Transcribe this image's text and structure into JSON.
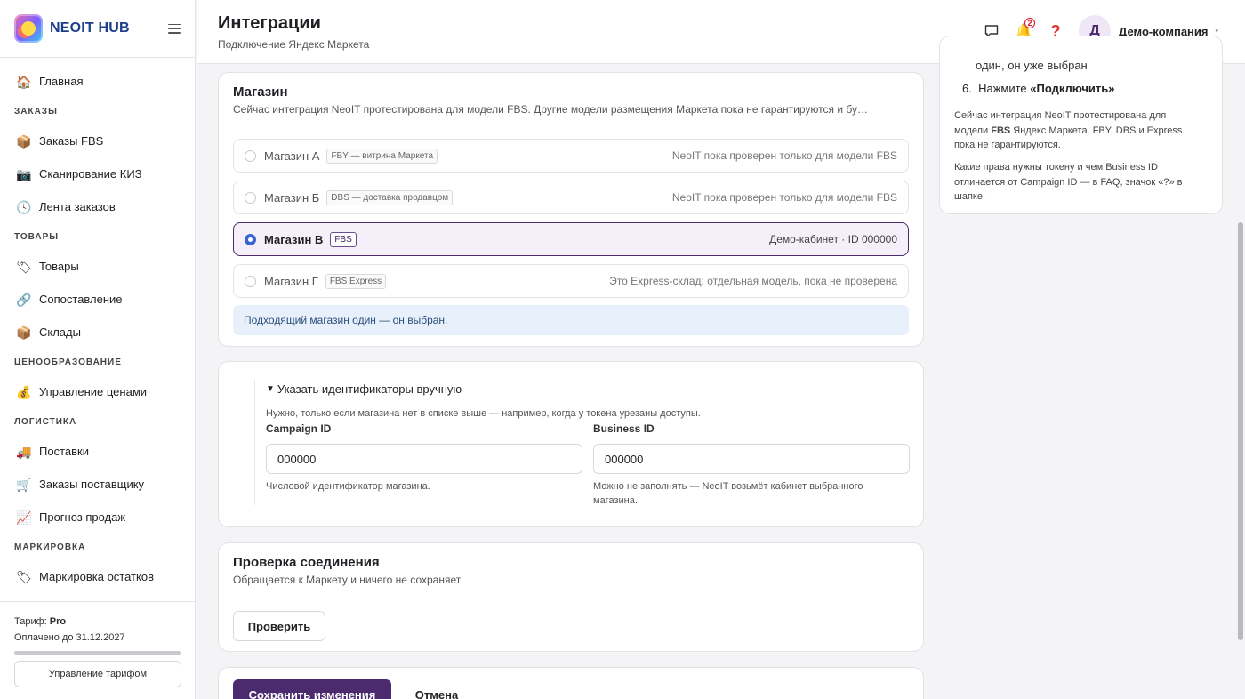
{
  "app": {
    "brand": "NEOIT HUB"
  },
  "sidebar": {
    "items": [
      {
        "label": "Главная",
        "icon": "🏠"
      },
      {
        "section": "ЗАКАЗЫ"
      },
      {
        "label": "Заказы FBS",
        "icon": "📦"
      },
      {
        "label": "Сканирование КИЗ",
        "icon": "📷"
      },
      {
        "label": "Лента заказов",
        "icon": "🕓"
      },
      {
        "section": "ТОВАРЫ"
      },
      {
        "label": "Товары",
        "icon": "🏷"
      },
      {
        "label": "Сопоставление",
        "icon": "🔗"
      },
      {
        "label": "Склады",
        "icon": "📦"
      },
      {
        "section": "ЦЕНООБРАЗОВАНИЕ"
      },
      {
        "label": "Управление ценами",
        "icon": "💰"
      },
      {
        "section": "ЛОГИСТИКА"
      },
      {
        "label": "Поставки",
        "icon": "🚚"
      },
      {
        "label": "Заказы поставщику",
        "icon": "🛒"
      },
      {
        "label": "Прогноз продаж",
        "icon": "📈"
      },
      {
        "section": "МАРКИРОВКА"
      },
      {
        "label": "Маркировка остатков",
        "icon": "🏷"
      }
    ],
    "footer": {
      "plan_label": "Тариф:",
      "plan_value": "Pro",
      "paid_until": "Оплачено до 31.12.2027",
      "manage_button": "Управление тарифом"
    }
  },
  "header": {
    "title": "Интеграции",
    "subtitle": "Подключение Яндекс Маркета",
    "notifications_count": "2",
    "help_glyph": "?",
    "avatar_letter": "Д",
    "company": "Демо-компания"
  },
  "store_card": {
    "title": "Магазин",
    "subtitle": "Сейчас интеграция NeoIT протестирована для модели FBS. Другие модели размещения Маркета пока не гарантируются и бу…",
    "stores": [
      {
        "name": "Магазин А",
        "tag": "FBY — витрина Маркета",
        "note": "NeoIT пока проверен только для модели FBS",
        "selected": false
      },
      {
        "name": "Магазин Б",
        "tag": "DBS — доставка продавцом",
        "note": "NeoIT пока проверен только для модели FBS",
        "selected": false
      },
      {
        "name": "Магазин В",
        "tag": "FBS",
        "note": "Демо-кабинет · ID 000000",
        "selected": true
      },
      {
        "name": "Магазин Г",
        "tag": "FBS Express",
        "note": "Это Express-склад: отдельная модель, пока не проверена",
        "selected": false
      }
    ],
    "info": "Подходящий магазин один — он выбран."
  },
  "ids_card": {
    "summary": "Указать идентификаторы вручную",
    "hint": "Нужно, только если магазина нет в списке выше — например, когда у токена урезаны доступы.",
    "campaign": {
      "label": "Campaign ID",
      "value": "000000",
      "help": "Числовой идентификатор магазина."
    },
    "business": {
      "label": "Business ID",
      "value": "000000",
      "help": "Можно не заполнять — NeoIT возьмёт кабинет выбранного магазина."
    }
  },
  "check_card": {
    "title": "Проверка соединения",
    "subtitle": "Обращается к Маркету и ничего не сохраняет",
    "button": "Проверить"
  },
  "actions": {
    "save": "Сохранить изменения",
    "cancel": "Отмена"
  },
  "help_panel": {
    "prev_step_tail": "один, он уже выбран",
    "step6_prefix": "Нажмите ",
    "step6_bold": "«Подключить»",
    "para1_prefix": "Сейчас интеграция NeoIT протестирована для модели ",
    "para1_bold": "FBS",
    "para1_suffix": " Яндекс Маркета. FBY, DBS и Express пока не гарантируются.",
    "para2": "Какие права нужны токену и чем Business ID отличается от Campaign ID — в FAQ, значок «?» в шапке."
  },
  "colors": {
    "accent": "#4b2a6e",
    "brand": "#1d3e8a",
    "info_bg": "#e8f1fb",
    "selected_bg": "#f4eff9"
  }
}
